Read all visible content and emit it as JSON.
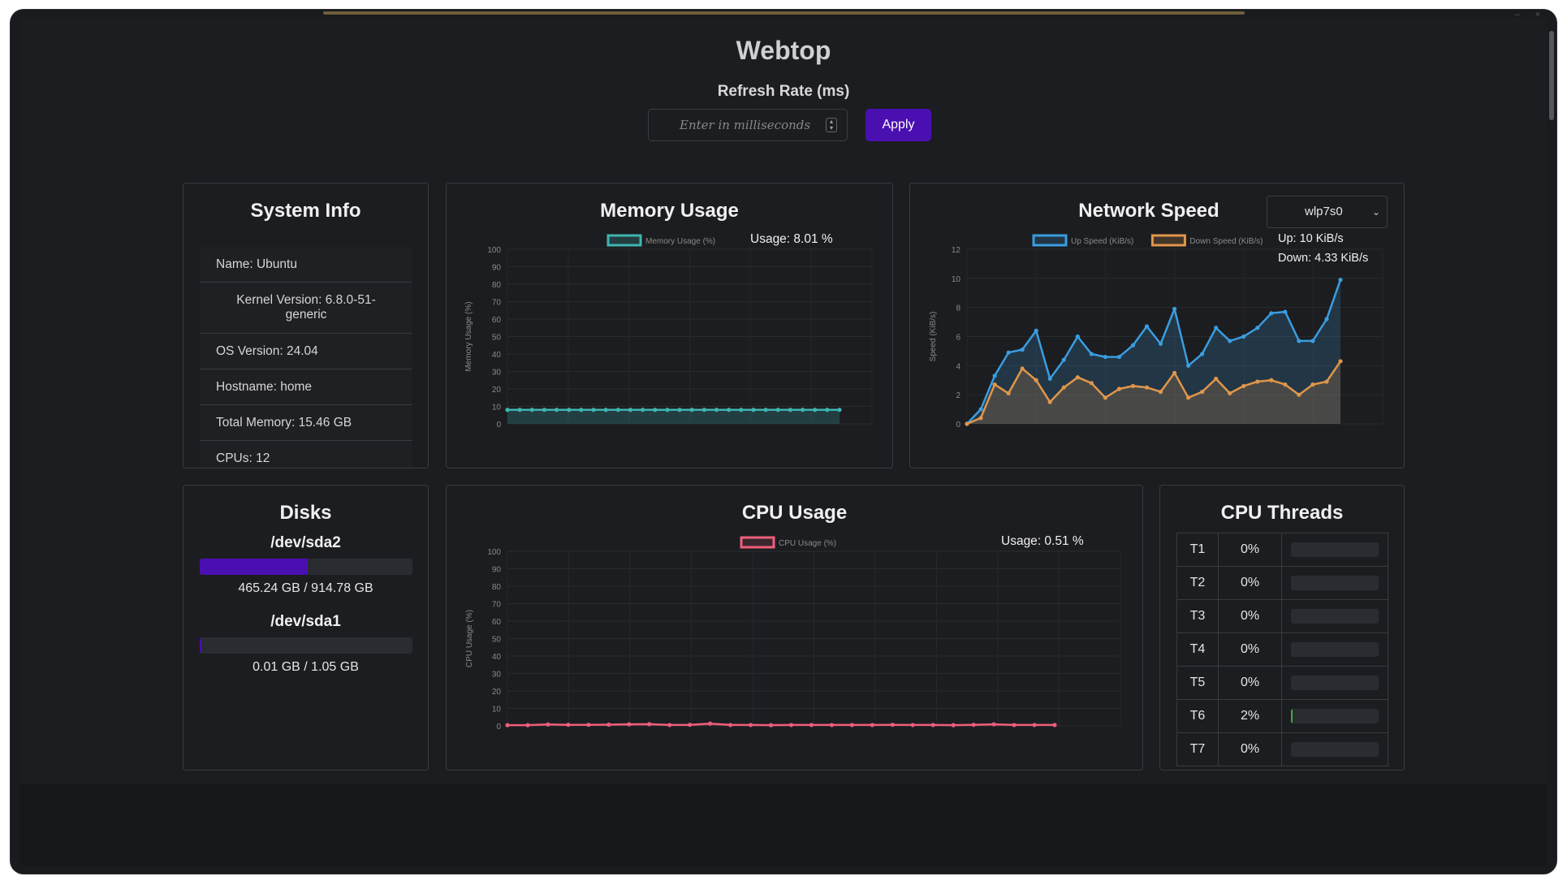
{
  "app": {
    "title": "Webtop"
  },
  "refresh": {
    "label": "Refresh Rate (ms)",
    "placeholder": "Enter in milliseconds",
    "apply_label": "Apply"
  },
  "system_info": {
    "title": "System Info",
    "items": [
      "Name: Ubuntu",
      "Kernel Version: 6.8.0-51-generic",
      "OS Version: 24.04",
      "Hostname: home",
      "Total Memory: 15.46 GB",
      "CPUs: 12"
    ]
  },
  "memory": {
    "title": "Memory Usage",
    "usage_text": "Usage: 8.01 %"
  },
  "network": {
    "title": "Network Speed",
    "interface": "wlp7s0",
    "up_text": "Up: 10 KiB/s",
    "down_text": "Down: 4.33 KiB/s"
  },
  "disks": {
    "title": "Disks",
    "items": [
      {
        "name": "/dev/sda2",
        "usage": "465.24 GB / 914.78 GB",
        "fraction": 0.5086
      },
      {
        "name": "/dev/sda1",
        "usage": "0.01 GB / 1.05 GB",
        "fraction": 0.0095
      }
    ]
  },
  "cpu": {
    "title": "CPU Usage",
    "usage_text": "Usage: 0.51 %"
  },
  "threads": {
    "title": "CPU Threads",
    "rows": [
      {
        "id": "T1",
        "pct": "0%",
        "value": 0
      },
      {
        "id": "T2",
        "pct": "0%",
        "value": 0
      },
      {
        "id": "T3",
        "pct": "0%",
        "value": 0
      },
      {
        "id": "T4",
        "pct": "0%",
        "value": 0
      },
      {
        "id": "T5",
        "pct": "0%",
        "value": 0
      },
      {
        "id": "T6",
        "pct": "2%",
        "value": 2
      },
      {
        "id": "T7",
        "pct": "0%",
        "value": 0
      }
    ]
  },
  "colors": {
    "accent": "#4a0fb0",
    "memory": "#3fb5b0",
    "up": "#3a9de0",
    "down": "#e0964a",
    "cpu": "#ee5e7a",
    "thread_bar": "#3fae3f"
  },
  "chart_data": [
    {
      "id": "memory",
      "type": "line",
      "legend": [
        "Memory Usage (%)"
      ],
      "ylabel": "Memory Usage (%)",
      "ylim": [
        0,
        100
      ],
      "yticks": [
        0,
        10,
        20,
        30,
        40,
        50,
        60,
        70,
        80,
        90,
        100
      ],
      "grid": true,
      "series": [
        {
          "name": "Memory Usage (%)",
          "values": [
            8.01,
            8.01,
            8.01,
            8.01,
            8.01,
            8.01,
            8.01,
            8.01,
            8.01,
            8.01,
            8.01,
            8.01,
            8.01,
            8.01,
            8.01,
            8.01,
            8.01,
            8.01,
            8.01,
            8.01,
            8.01,
            8.01,
            8.01,
            8.01,
            8.01,
            8.01,
            8.01,
            8.01
          ]
        }
      ]
    },
    {
      "id": "network",
      "type": "area",
      "legend": [
        "Up Speed (KiB/s)",
        "Down Speed (KiB/s)"
      ],
      "ylabel": "Speed (KiB/s)",
      "ylim": [
        0,
        12
      ],
      "yticks": [
        0,
        2,
        4,
        6,
        8,
        10,
        12
      ],
      "grid": true,
      "series": [
        {
          "name": "Up Speed (KiB/s)",
          "values": [
            0,
            1,
            3.3,
            4.9,
            5.1,
            6.4,
            3.1,
            4.4,
            6.0,
            4.8,
            4.6,
            4.6,
            5.4,
            6.7,
            5.5,
            7.9,
            4.0,
            4.8,
            6.6,
            5.7,
            6.0,
            6.6,
            7.6,
            7.7,
            5.7,
            5.7,
            7.2,
            9.9
          ]
        },
        {
          "name": "Down Speed (KiB/s)",
          "values": [
            0,
            0.4,
            2.7,
            2.1,
            3.8,
            3.0,
            1.5,
            2.5,
            3.2,
            2.8,
            1.8,
            2.4,
            2.6,
            2.5,
            2.2,
            3.5,
            1.8,
            2.2,
            3.1,
            2.1,
            2.6,
            2.9,
            3.0,
            2.7,
            2.0,
            2.7,
            2.9,
            4.3
          ]
        }
      ]
    },
    {
      "id": "cpu",
      "type": "line",
      "legend": [
        "CPU Usage (%)"
      ],
      "ylabel": "CPU Usage (%)",
      "ylim": [
        0,
        100
      ],
      "yticks": [
        0,
        10,
        20,
        30,
        40,
        50,
        60,
        70,
        80,
        90,
        100
      ],
      "grid": true,
      "series": [
        {
          "name": "CPU Usage (%)",
          "values": [
            0.4,
            0.4,
            0.8,
            0.6,
            0.6,
            0.7,
            0.9,
            1.0,
            0.5,
            0.6,
            1.3,
            0.5,
            0.5,
            0.4,
            0.5,
            0.5,
            0.5,
            0.5,
            0.5,
            0.6,
            0.5,
            0.5,
            0.4,
            0.6,
            0.9,
            0.5,
            0.5,
            0.51
          ]
        }
      ]
    }
  ]
}
